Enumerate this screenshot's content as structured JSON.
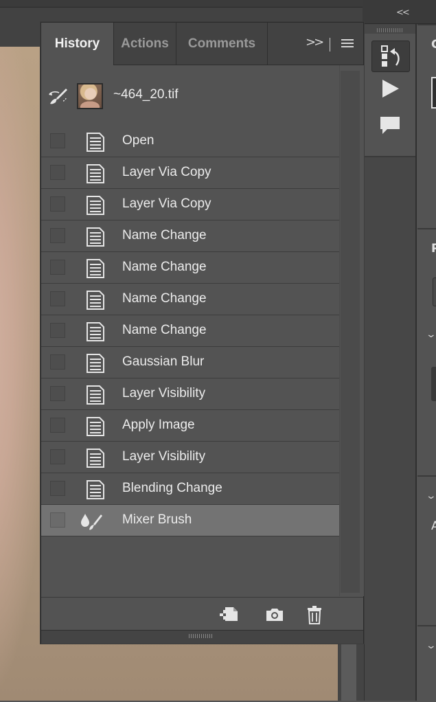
{
  "dock": {
    "collapse_label": "<<"
  },
  "right_panels": {
    "letters": [
      "C",
      "P",
      "A"
    ]
  },
  "history": {
    "tabs": [
      {
        "label": "History",
        "active": true
      },
      {
        "label": "Actions",
        "active": false
      },
      {
        "label": "Comments",
        "active": false
      }
    ],
    "overflow_label": ">>",
    "snapshot": {
      "name": "~464_20.tif"
    },
    "items": [
      {
        "label": "Open",
        "icon": "document-icon",
        "selected": false
      },
      {
        "label": "Layer Via Copy",
        "icon": "document-icon",
        "selected": false
      },
      {
        "label": "Layer Via Copy",
        "icon": "document-icon",
        "selected": false
      },
      {
        "label": "Name Change",
        "icon": "document-icon",
        "selected": false
      },
      {
        "label": "Name Change",
        "icon": "document-icon",
        "selected": false
      },
      {
        "label": "Name Change",
        "icon": "document-icon",
        "selected": false
      },
      {
        "label": "Name Change",
        "icon": "document-icon",
        "selected": false
      },
      {
        "label": "Gaussian Blur",
        "icon": "document-icon",
        "selected": false
      },
      {
        "label": "Layer Visibility",
        "icon": "document-icon",
        "selected": false
      },
      {
        "label": "Apply Image",
        "icon": "document-icon",
        "selected": false
      },
      {
        "label": "Layer Visibility",
        "icon": "document-icon",
        "selected": false
      },
      {
        "label": "Blending Change",
        "icon": "document-icon",
        "selected": false
      },
      {
        "label": "Mixer Brush",
        "icon": "mixer-brush-icon",
        "selected": true
      }
    ],
    "footer": {
      "buttons": [
        "new-document-from-state-icon",
        "camera-icon",
        "trash-icon"
      ]
    }
  },
  "colors": {
    "panel_bg": "#535353",
    "tab_bar_bg": "#424242",
    "selected_row_bg": "#737373",
    "text": "#ececec"
  }
}
